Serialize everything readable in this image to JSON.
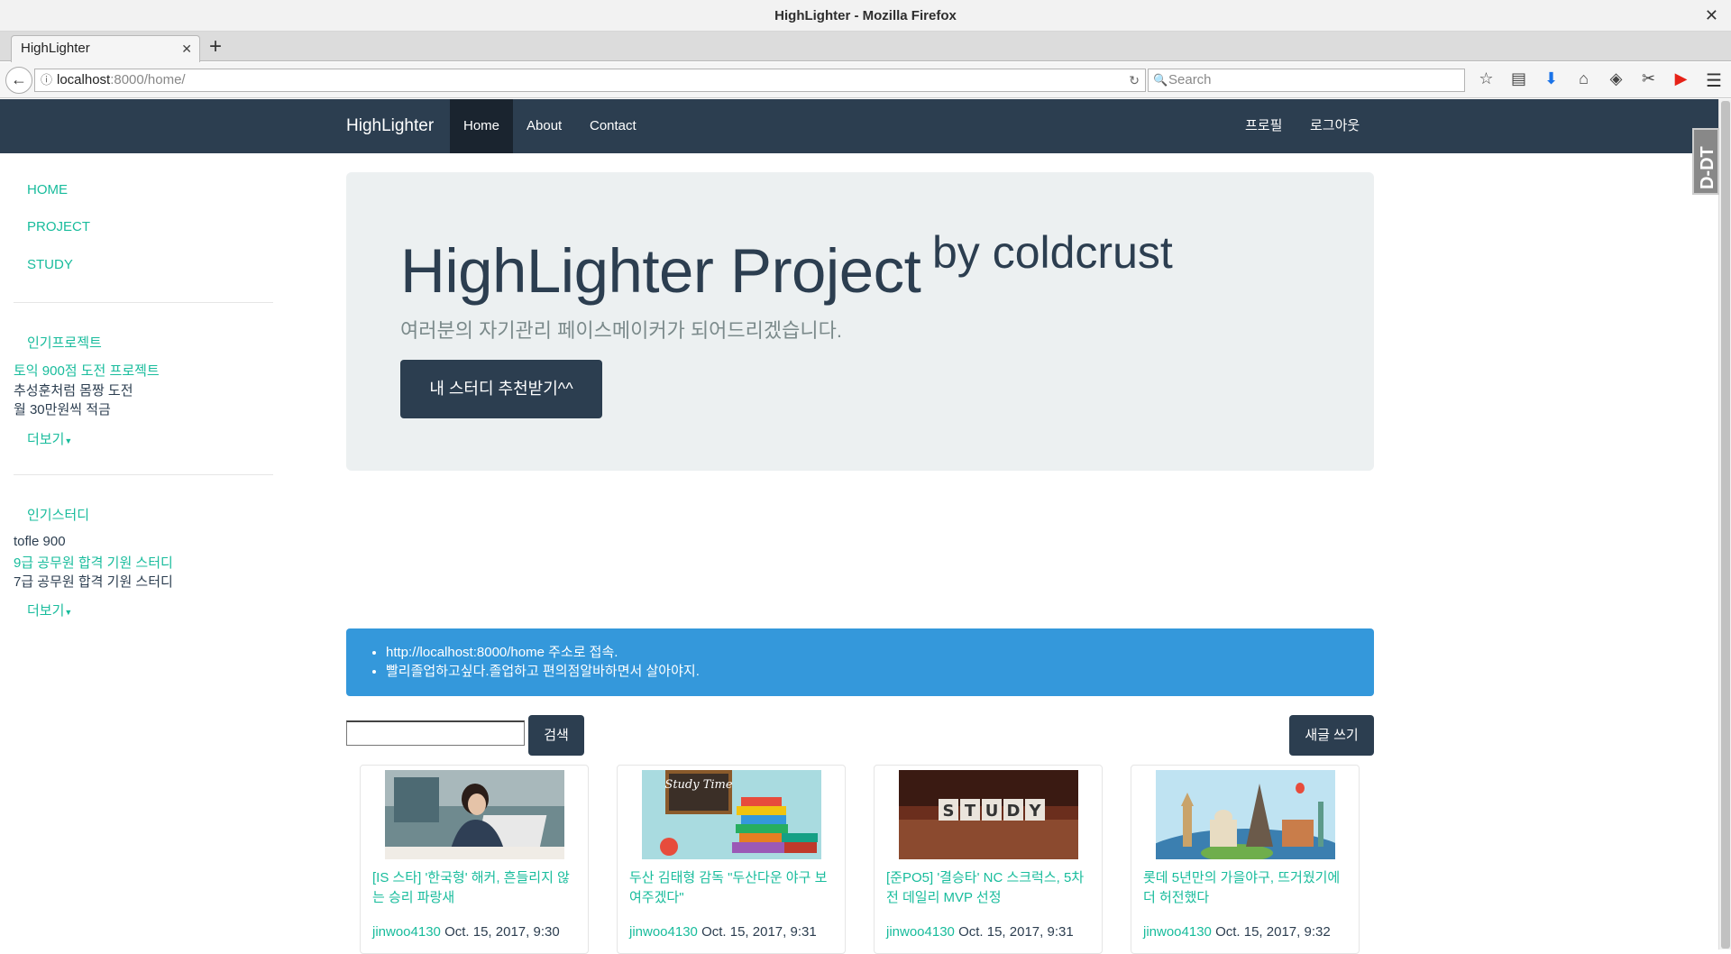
{
  "window": {
    "title": "HighLighter - Mozilla Firefox"
  },
  "tab": {
    "label": "HighLighter"
  },
  "address": {
    "host": "localhost",
    "rest": ":8000/home/"
  },
  "search": {
    "placeholder": "Search"
  },
  "site": {
    "brand": "HighLighter",
    "nav": [
      "Home",
      "About",
      "Contact"
    ],
    "nav_right": [
      "프로필",
      "로그아웃"
    ]
  },
  "sidebar": {
    "links": [
      "HOME",
      "PROJECT",
      "STUDY"
    ],
    "popular_projects": {
      "heading": "인기프로젝트",
      "items": [
        "토익 900점 도전 프로젝트",
        "추성훈처럼 몸짱 도전",
        "월 30만원씩 적금"
      ],
      "more": "더보기"
    },
    "popular_studies": {
      "heading": "인기스터디",
      "items": [
        "tofle 900",
        "9급 공무원 합격 기원 스터디",
        "7급 공무원 합격 기원 스터디"
      ],
      "more": "더보기"
    }
  },
  "jumbotron": {
    "title": "HighLighter Project",
    "by": "by coldcrust",
    "lead": "여러분의 자기관리 페이스메이커가 되어드리겠습니다.",
    "button": "내 스터디 추천받기^^"
  },
  "notice": [
    "http://localhost:8000/home 주소로 접속.",
    "빨리졸업하고싶다.졸업하고 편의점알바하면서 살아야지."
  ],
  "toolbar": {
    "search_button": "검색",
    "write_button": "새글 쓰기"
  },
  "cards": [
    {
      "title": "[IS 스타] '한국형' 해커, 흔들리지 않는 승리 파랑새",
      "author": "jinwoo4130",
      "date": "Oct. 15, 2017, 9:30"
    },
    {
      "title": "두산 김태형 감독 \"두산다운 야구 보여주겠다\"",
      "author": "jinwoo4130",
      "date": "Oct. 15, 2017, 9:31"
    },
    {
      "title": "[준PO5] '결승타' NC 스크럭스, 5차전 데일리 MVP 선정",
      "author": "jinwoo4130",
      "date": "Oct. 15, 2017, 9:31"
    },
    {
      "title": "롯데 5년만의 가을야구, 뜨거웠기에 더 허전했다",
      "author": "jinwoo4130",
      "date": "Oct. 15, 2017, 9:32"
    }
  ],
  "card_images": {
    "study_time_text": "Study Time",
    "study_blocks": [
      "S",
      "T",
      "U",
      "D",
      "Y"
    ]
  },
  "addon": {
    "label": "D-DT"
  }
}
